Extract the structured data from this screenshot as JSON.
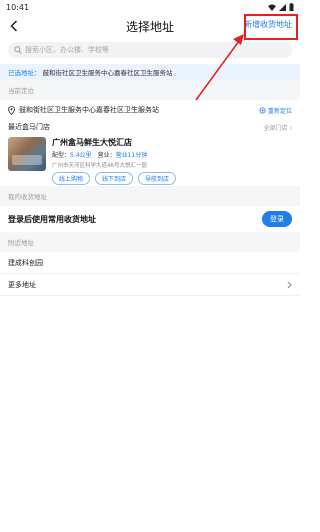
{
  "status_bar": {
    "time": "10:41"
  },
  "header": {
    "title": "选择地址",
    "new_address_label": "新增收货地址"
  },
  "search": {
    "placeholder": "搜索小区、办公楼、学校等"
  },
  "notice": {
    "prefix": "已选地址：",
    "text": "鼓和街社区卫生服务中心嘉春社区卫生服务站"
  },
  "current_location": {
    "section_label": "当前定位",
    "address": "鼓和街社区卫生服务中心嘉春社区卫生服务站",
    "relocate_label": "重新定位"
  },
  "nearby_stores": {
    "title": "最近盒马门店",
    "view_all_label": "全部门店",
    "store": {
      "name": "广州盒马鲜生大悦汇店",
      "metrics": [
        {
          "key": "配型：",
          "value": "5.4公里"
        },
        {
          "key": "营业：",
          "value": "营业11分钟"
        }
      ],
      "address": "广州市天河区科学大道46号大悦汇一层",
      "tags": [
        "线上购物",
        "线下到店",
        "导航到店"
      ]
    }
  },
  "my_addresses": {
    "section_label": "我的收货地址",
    "login_prompt": "登录后使用常用收货地址",
    "login_button": "登录"
  },
  "nearby_addresses": {
    "section_label": "附近地址",
    "items": [
      "建成科创园"
    ],
    "more_label": "更多地址"
  },
  "colors": {
    "accent": "#1f7ee8",
    "annotation": "#e52020",
    "notice_bg": "#eaf3fe",
    "section_bg": "#f5f6f7"
  }
}
